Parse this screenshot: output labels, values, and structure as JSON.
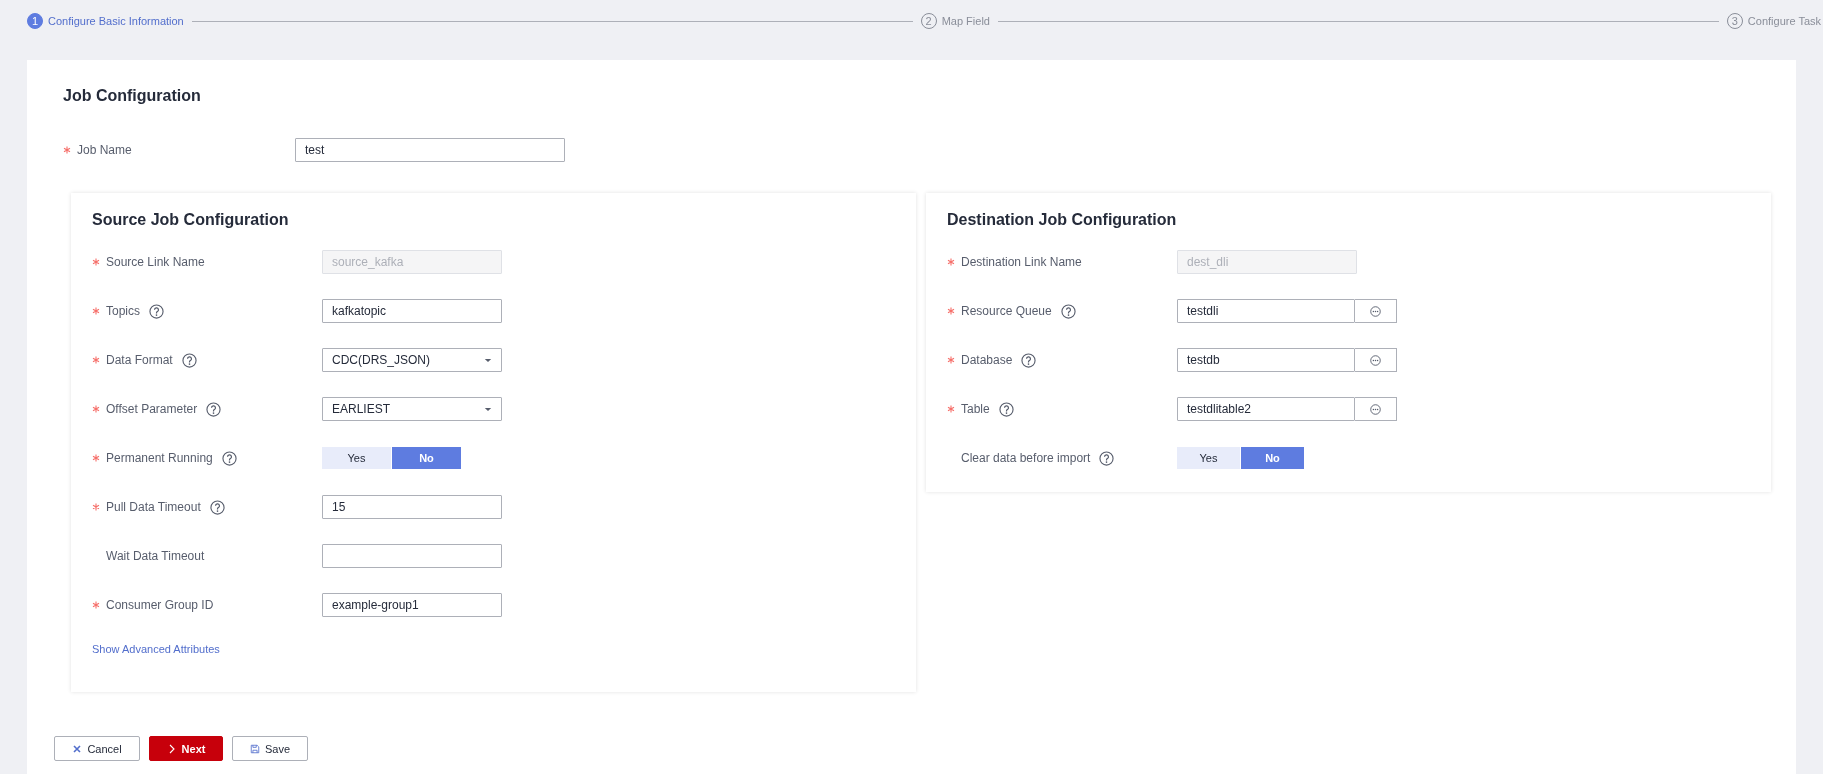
{
  "steps": [
    {
      "number": "1",
      "label": "Configure Basic Information",
      "selected": true
    },
    {
      "number": "2",
      "label": "Map Field",
      "selected": false
    },
    {
      "number": "3",
      "label": "Configure Task",
      "selected": false
    }
  ],
  "job_configuration": {
    "title": "Job Configuration",
    "job_name": {
      "label": "Job Name",
      "required": true,
      "value": "test"
    }
  },
  "source": {
    "title": "Source Job Configuration",
    "fields": [
      {
        "kind": "readonly",
        "label": "Source Link Name",
        "required": true,
        "help": false,
        "value": "source_kafka"
      },
      {
        "kind": "text",
        "label": "Topics",
        "required": true,
        "help": true,
        "value": "kafkatopic"
      },
      {
        "kind": "select",
        "label": "Data Format",
        "required": true,
        "help": true,
        "value": "CDC(DRS_JSON)"
      },
      {
        "kind": "select",
        "label": "Offset Parameter",
        "required": true,
        "help": true,
        "value": "EARLIEST"
      },
      {
        "kind": "toggle",
        "label": "Permanent Running",
        "required": true,
        "help": true,
        "options": [
          {
            "label": "Yes",
            "selected": false
          },
          {
            "label": "No",
            "selected": true
          }
        ]
      },
      {
        "kind": "text",
        "label": "Pull Data Timeout",
        "required": true,
        "help": true,
        "value": "15"
      },
      {
        "kind": "text",
        "label": "Wait Data Timeout",
        "required": false,
        "help": false
      },
      {
        "kind": "text",
        "label": "Consumer Group ID",
        "required": true,
        "help": false,
        "value": "example-group1"
      }
    ],
    "advanced_link": "Show Advanced Attributes"
  },
  "destination": {
    "title": "Destination Job Configuration",
    "fields": [
      {
        "kind": "readonly",
        "label": "Destination Link Name",
        "required": true,
        "help": false,
        "value": "dest_dli"
      },
      {
        "kind": "lookup",
        "label": "Resource Queue",
        "required": true,
        "help": true,
        "value": "testdli"
      },
      {
        "kind": "lookup",
        "label": "Database",
        "required": true,
        "help": true,
        "value": "testdb"
      },
      {
        "kind": "lookup",
        "label": "Table",
        "required": true,
        "help": true,
        "value": "testdlitable2"
      },
      {
        "kind": "toggle",
        "label": "Clear data before import",
        "required": false,
        "help": true,
        "options": [
          {
            "label": "Yes",
            "selected": false
          },
          {
            "label": "No",
            "selected": true
          }
        ]
      }
    ]
  },
  "buttons": [
    {
      "kind": "cancel",
      "label": "Cancel"
    },
    {
      "kind": "next",
      "label": "Next"
    },
    {
      "kind": "save",
      "label": "Save"
    }
  ]
}
